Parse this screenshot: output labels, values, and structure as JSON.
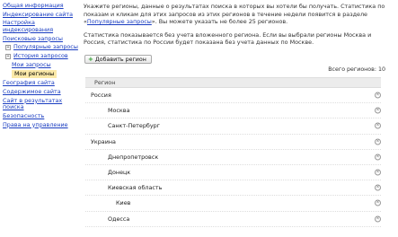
{
  "sidebar": {
    "general": "Общая информация",
    "indexing": "Индексирование сайта",
    "indexing_settings": "Настройка индексирования",
    "search_queries": "Поисковые запросы",
    "popular": "Популярные запросы",
    "history": "История запросов",
    "my_queries": "Мои запросы",
    "my_regions": "Мои регионы",
    "geo": "География сайта",
    "content": "Содержимое сайта",
    "site_in_results": "Сайт в результатах поиска",
    "security": "Безопасность",
    "rights": "Права на управление",
    "toggle_symbol": "+"
  },
  "main": {
    "intro_text": "Укажите регионы, данные о результатах поиска в которых вы хотели бы получать. Статистика по показам и кликам для этих запросов из этих регионов в течение недели появится в разделе «",
    "intro_link": "Популярные запросы",
    "intro_tail": "». Вы можете указать не более 25 регионов.",
    "note": "Статистика показывается без учета вложенного региона. Если вы выбрали регионы Москва и Россия, статистика по России будет показана без учета данных по Москве.",
    "add_button": "Добавить регион",
    "add_plus": "+",
    "total": "Всего регионов: 10",
    "column_region": "Регион",
    "delete_symbol": "×"
  },
  "regions": [
    {
      "name": "Россия",
      "level": 0
    },
    {
      "name": "Москва",
      "level": 1
    },
    {
      "name": "Санкт-Петербург",
      "level": 1
    },
    {
      "name": "Украина",
      "level": 0
    },
    {
      "name": "Днепропетровск",
      "level": 1
    },
    {
      "name": "Донецк",
      "level": 1
    },
    {
      "name": "Киевская область",
      "level": 1
    },
    {
      "name": "Киев",
      "level": 2
    },
    {
      "name": "Одесса",
      "level": 1
    }
  ]
}
